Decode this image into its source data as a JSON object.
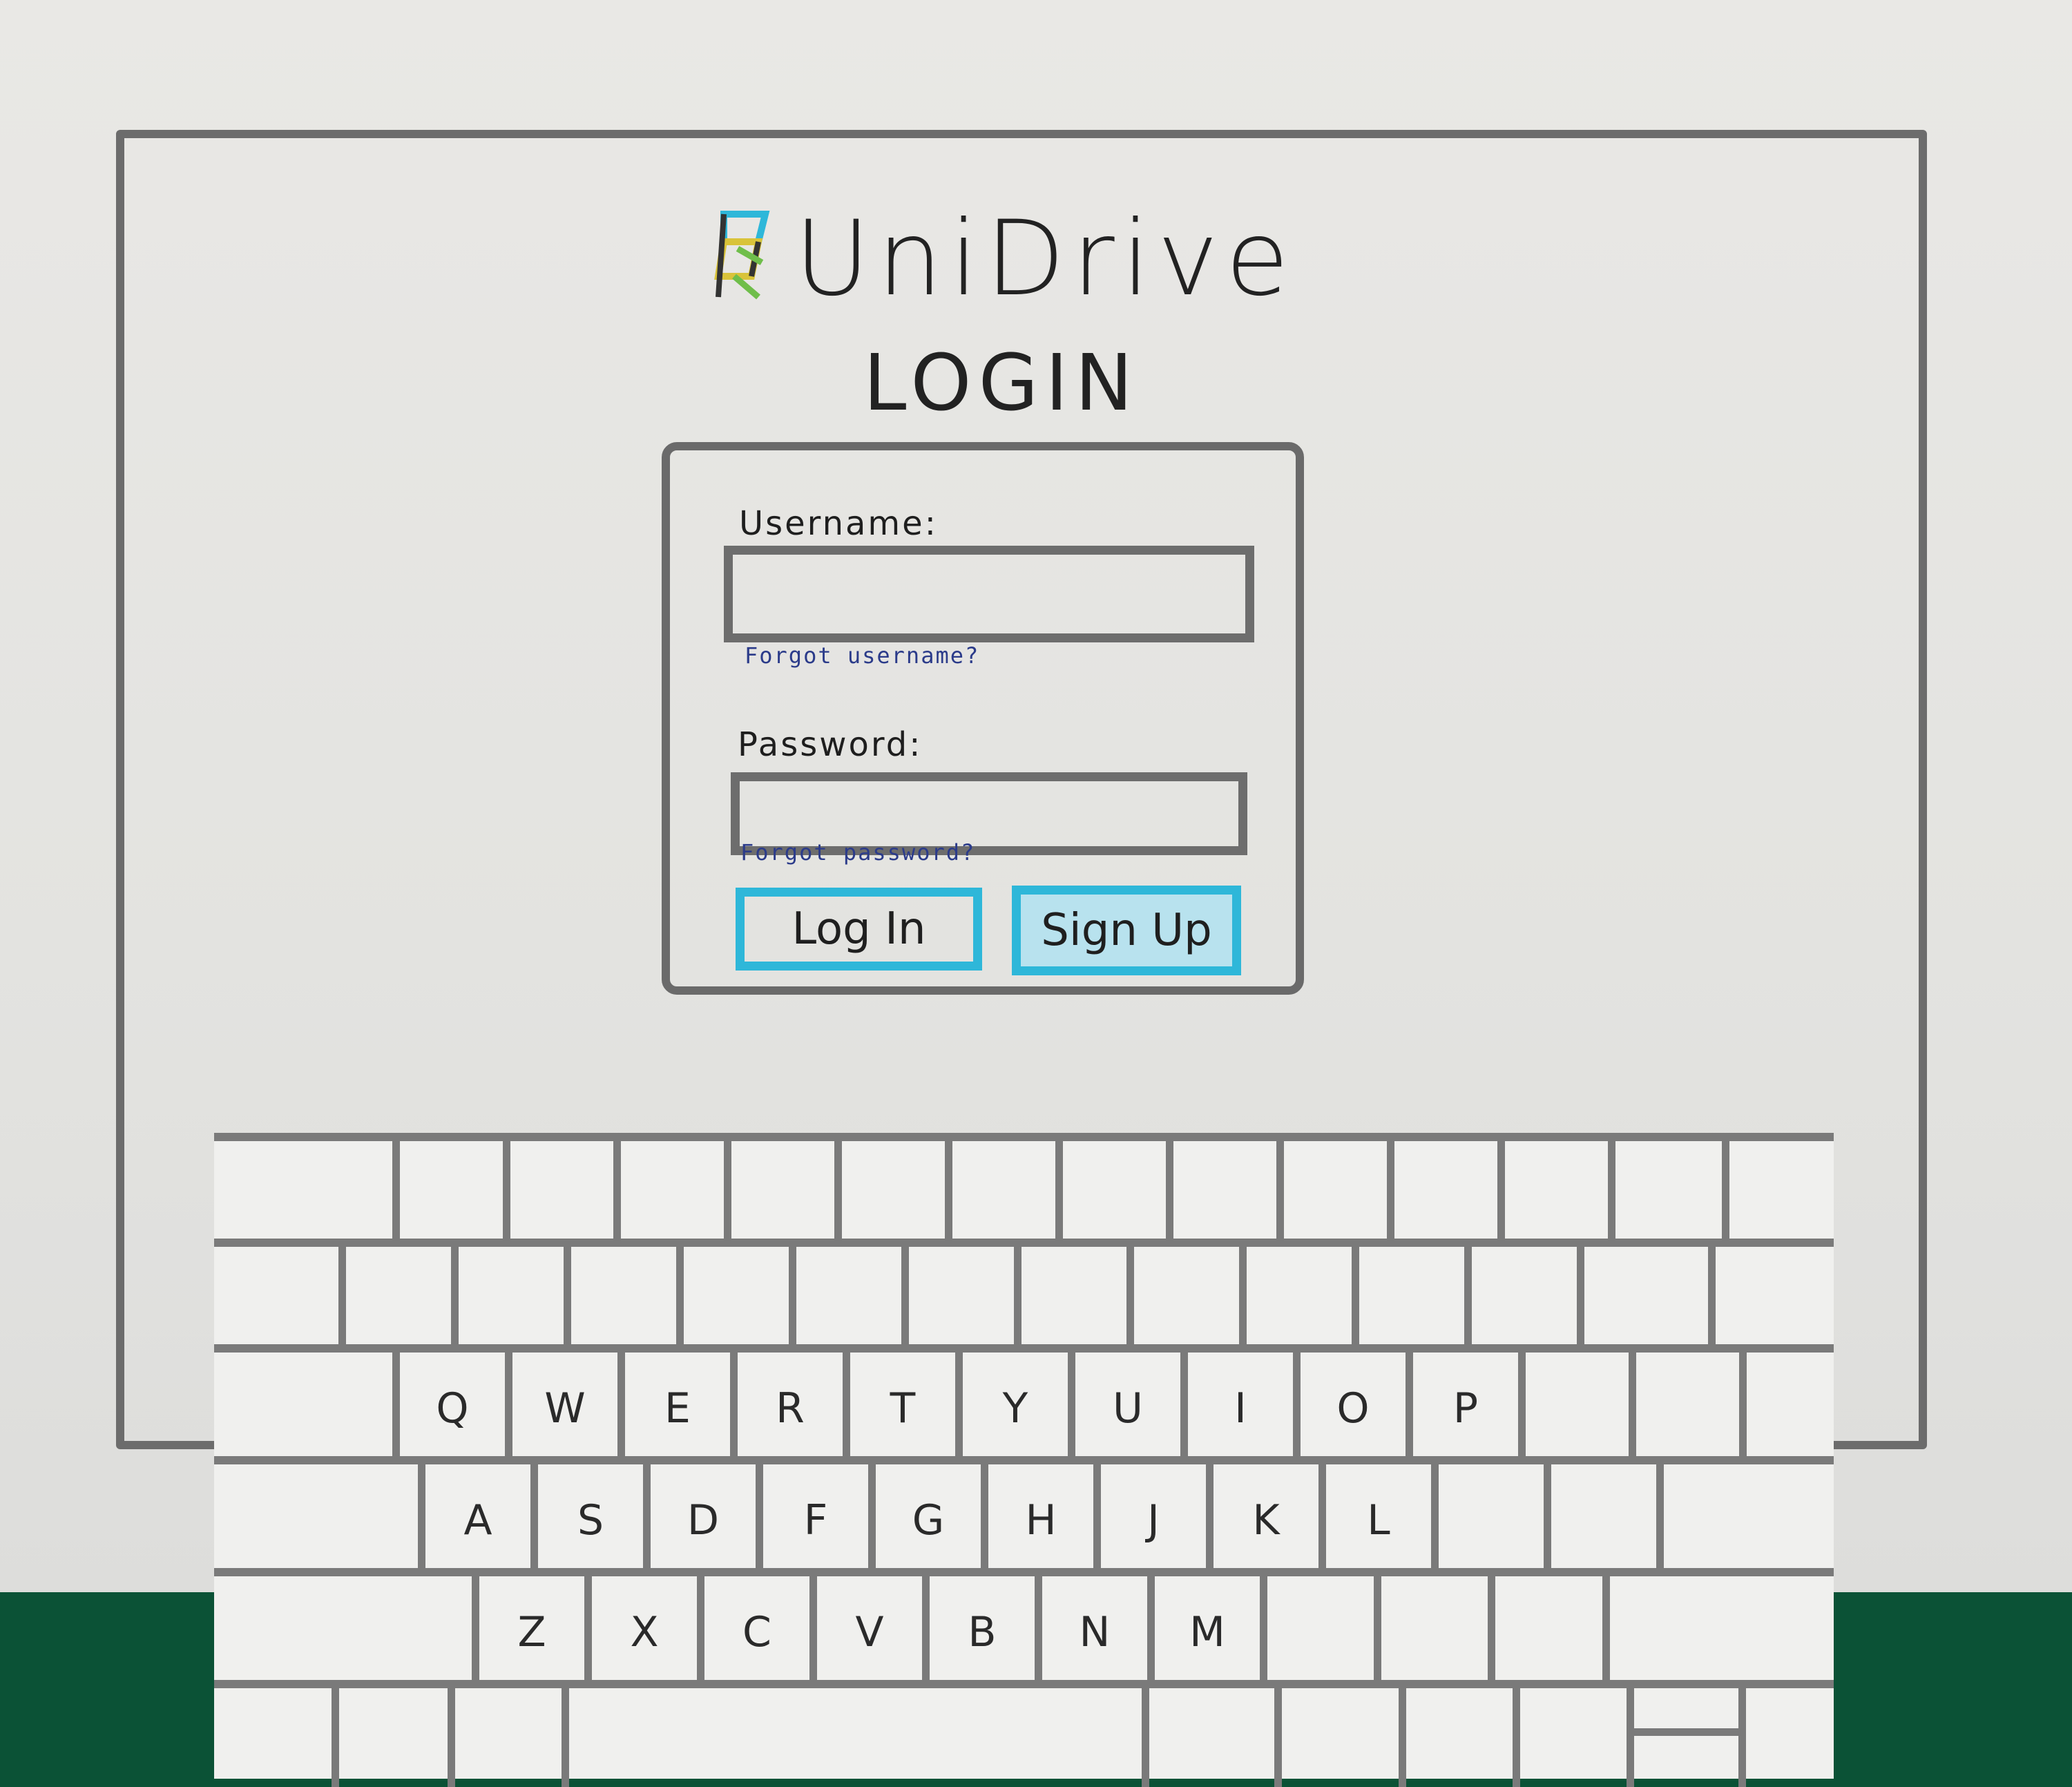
{
  "app": {
    "name": "UniDrive"
  },
  "login": {
    "title": "LOGIN",
    "username_label": "Username:",
    "username_value": "",
    "forgot_username": "Forgot username?",
    "password_label": "Password:",
    "password_value": "",
    "forgot_password": "Forgot password?",
    "login_button": "Log In",
    "signup_button": "Sign Up"
  },
  "keyboard": {
    "row3": [
      "Q",
      "W",
      "E",
      "R",
      "T",
      "Y",
      "U",
      "I",
      "O",
      "P"
    ],
    "row4": [
      "A",
      "S",
      "D",
      "F",
      "G",
      "H",
      "J",
      "K",
      "L"
    ],
    "row5": [
      "Z",
      "X",
      "C",
      "V",
      "B",
      "N",
      "M"
    ]
  },
  "colors": {
    "accent": "#2eb7d9",
    "link": "#2b3b8a",
    "frame": "#6c6c6c"
  }
}
